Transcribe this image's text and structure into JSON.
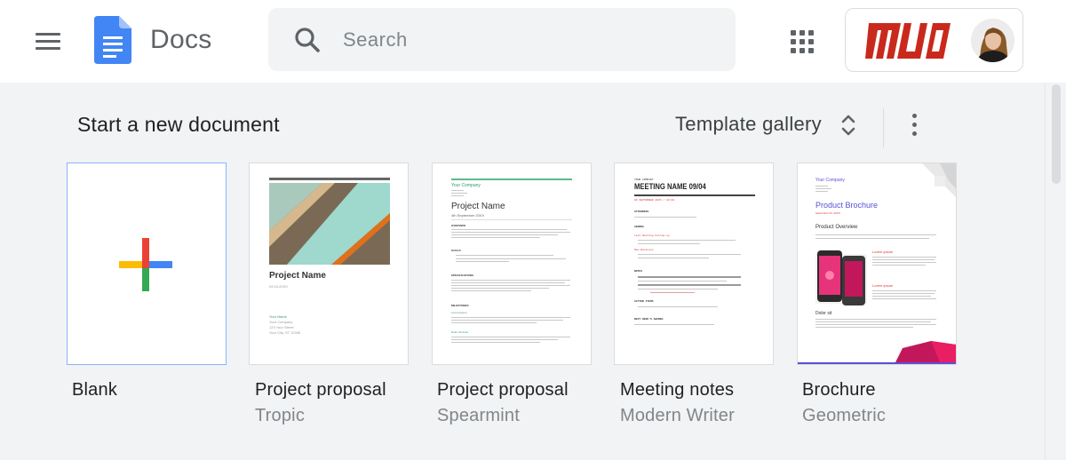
{
  "header": {
    "app_name": "Docs",
    "search_placeholder": "Search",
    "icons": [
      "menu-icon",
      "docs-logo",
      "search-icon",
      "apps-grid-icon",
      "avatar"
    ]
  },
  "section": {
    "title": "Start a new document",
    "gallery_label": "Template gallery"
  },
  "templates": [
    {
      "title": "Blank",
      "subtitle": ""
    },
    {
      "title": "Project proposal",
      "subtitle": "Tropic",
      "preview": {
        "heading": "Project Name",
        "date": "09.04.20XX",
        "lines": [
          "Your Name",
          "Your Company",
          "123 Your Street",
          "Your City, ST 12345"
        ]
      }
    },
    {
      "title": "Project proposal",
      "subtitle": "Spearmint",
      "preview": {
        "company": "Your Company",
        "heading": "Project Name",
        "date": "4th September 20XX",
        "sections": [
          "OVERVIEW",
          "GOALS",
          "SPECIFICATIONS",
          "MILESTONES",
          "Lorem Ipsum",
          "Dolor Sit Amet"
        ]
      }
    },
    {
      "title": "Meeting notes",
      "subtitle": "Modern Writer",
      "preview": {
        "company": "YOUR COMPANY",
        "heading": "MEETING NAME 09/04",
        "date": "09 SEPTEMBER 20XX / 10:00",
        "sections": [
          "ATTENDEES",
          "AGENDA",
          "Last Meeting Follow-up",
          "New Business",
          "NOTES",
          "ACTION ITEMS",
          "NEXT WEEK'S AGENDA"
        ]
      }
    },
    {
      "title": "Brochure",
      "subtitle": "Geometric",
      "preview": {
        "company": "Your Company",
        "heading": "Product Brochure",
        "date": "September 04, 20XX",
        "sections": [
          "Product Overview",
          "Lorem ipsum",
          "Lorem ipsum",
          "Dolor sit"
        ]
      }
    }
  ],
  "brand": {
    "logo_text": "MUO"
  },
  "colors": {
    "accent_blue": "#4285f4",
    "plus_red": "#ea4335",
    "plus_yellow": "#fbbc04",
    "plus_green": "#34a853",
    "plus_blue": "#4285f4"
  }
}
